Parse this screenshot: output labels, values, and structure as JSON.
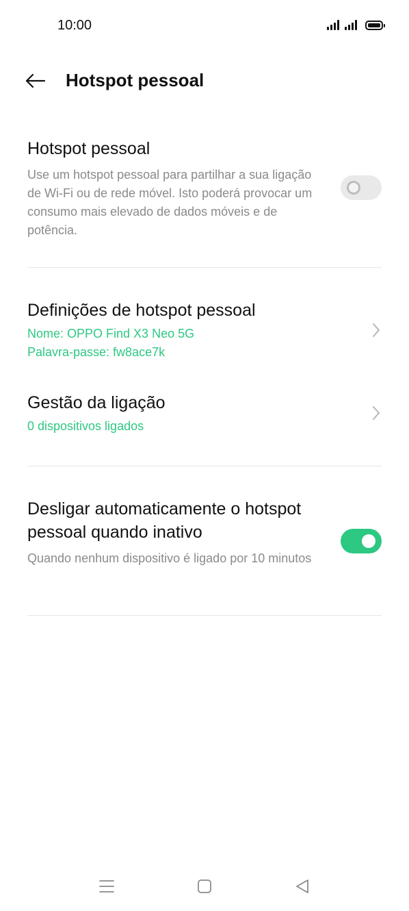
{
  "status_bar": {
    "time": "10:00",
    "icons": [
      "signal-icon",
      "signal-icon",
      "battery-icon"
    ]
  },
  "header": {
    "back_icon": "arrow-left-icon",
    "title": "Hotspot pessoal"
  },
  "hotspot": {
    "title": "Hotspot pessoal",
    "description": "Use um hotspot pessoal para partilhar a sua ligação de Wi-Fi ou de rede móvel. Isto poderá provocar um consumo mais elevado de dados móveis e de potência.",
    "enabled": false
  },
  "settings": {
    "title": "Definições de hotspot pessoal",
    "name_line": "Nome: OPPO Find X3 Neo 5G",
    "password_line": "Palavra-passe: fw8ace7k"
  },
  "connection": {
    "title": "Gestão da ligação",
    "subtitle": "0 dispositivos ligados"
  },
  "auto_off": {
    "title": "Desligar automaticamente o hotspot pessoal quando inativo",
    "description": "Quando nenhum dispositivo é ligado por 10 minutos",
    "enabled": true
  },
  "colors": {
    "accent": "#2dc882",
    "secondary_text": "#8a8a8a",
    "divider": "#e6e6e6"
  },
  "nav_bar": {
    "icons": [
      "menu-icon",
      "home-icon",
      "back-triangle-icon"
    ]
  }
}
